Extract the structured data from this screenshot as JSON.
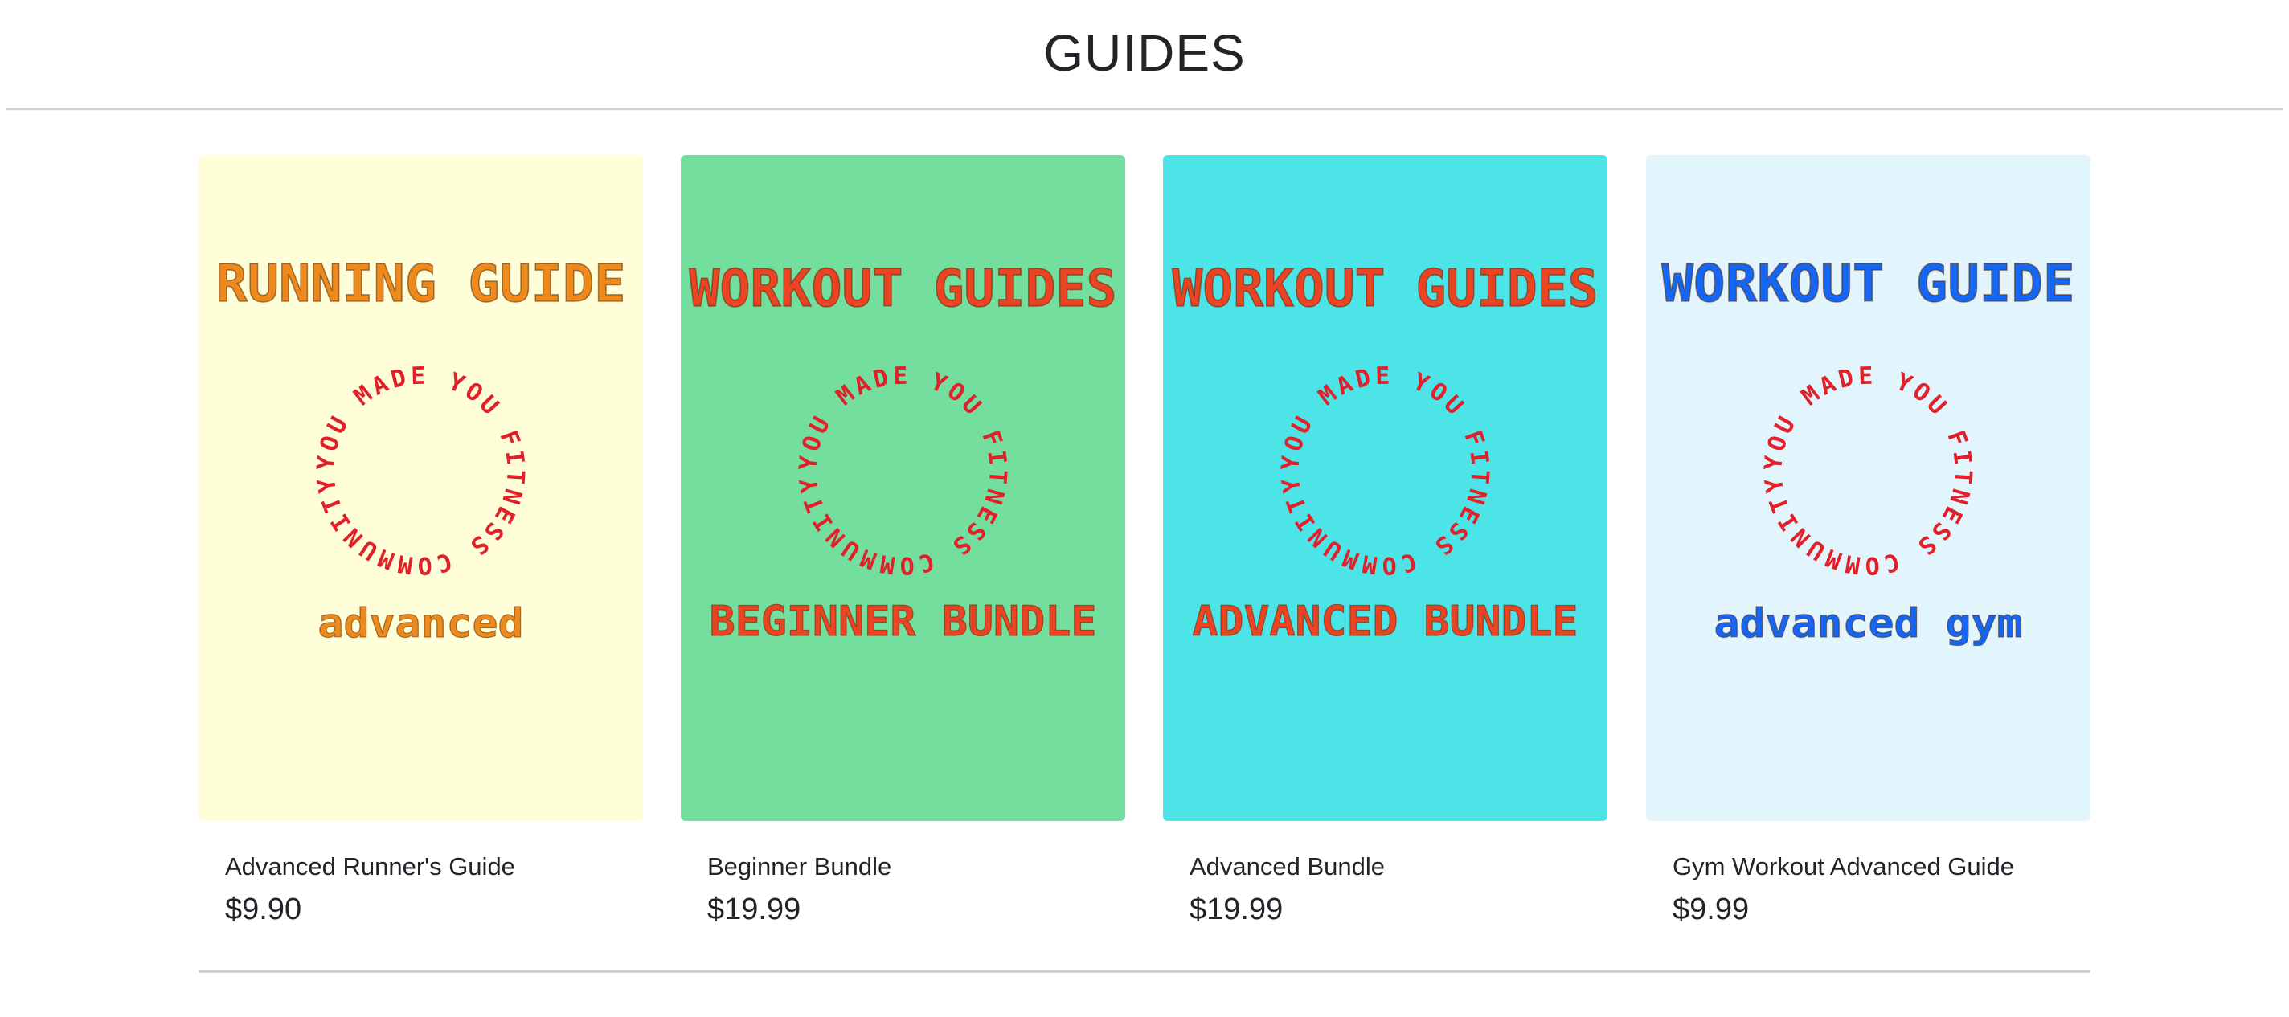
{
  "page": {
    "title": "GUIDES"
  },
  "products": [
    {
      "name": "Advanced Runner's Guide",
      "price": "$9.90",
      "cover": {
        "heading": "RUNNING GUIDE",
        "circle_text": "YOU MADE YOU FITNESS COMMUNITY",
        "subheading": "advanced",
        "background": "#fefed8",
        "heading_color": "#ee8a1c",
        "subheading_color": "#ee8a1c",
        "circle_color": "#e2202a"
      }
    },
    {
      "name": "Beginner Bundle",
      "price": "$19.99",
      "cover": {
        "heading": "WORKOUT GUIDES",
        "circle_text": "YOU MADE YOU FITNESS COMMUNITY",
        "subheading": "BEGINNER BUNDLE",
        "background": "#73de9d",
        "heading_color": "#ea4424",
        "subheading_color": "#ea4424",
        "circle_color": "#e2202a"
      }
    },
    {
      "name": "Advanced Bundle",
      "price": "$19.99",
      "cover": {
        "heading": "WORKOUT GUIDES",
        "circle_text": "YOU MADE YOU FITNESS COMMUNITY",
        "subheading": "ADVANCED BUNDLE",
        "background": "#4de4e8",
        "heading_color": "#ea4424",
        "subheading_color": "#ea4424",
        "circle_color": "#e2202a"
      }
    },
    {
      "name": "Gym Workout Advanced Guide",
      "price": "$9.99",
      "cover": {
        "heading": "WORKOUT GUIDE",
        "circle_text": "YOU MADE YOU FITNESS COMMUNITY",
        "subheading": "advanced gym",
        "background": "#e2f4fc",
        "heading_color": "#1466f4",
        "subheading_color": "#1466f4",
        "circle_color": "#e2202a"
      }
    }
  ]
}
